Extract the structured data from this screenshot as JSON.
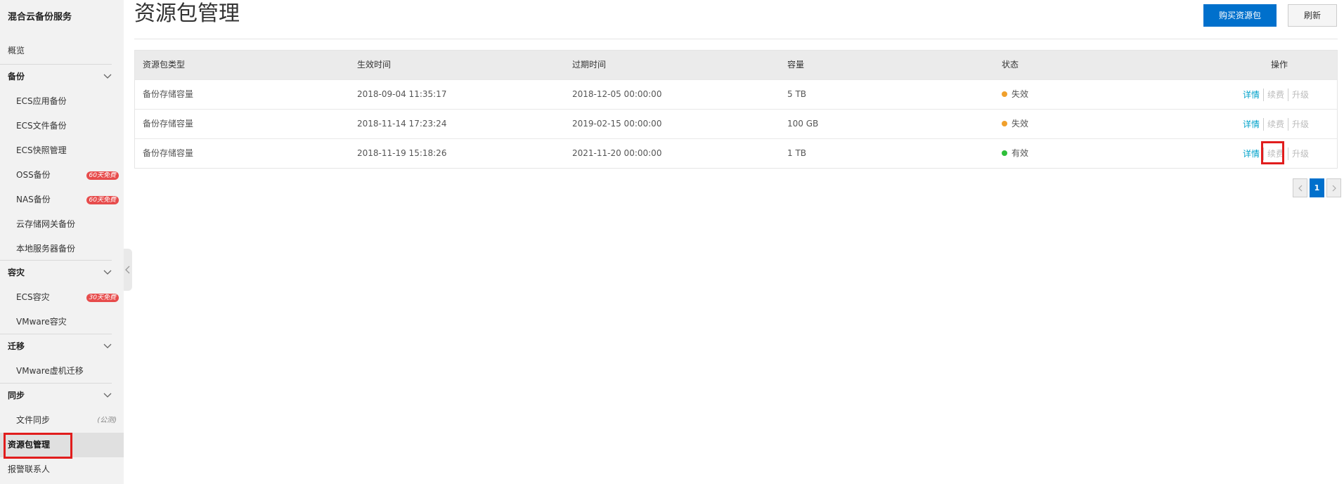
{
  "sidebar": {
    "title": "混合云备份服务",
    "overview": "概览",
    "groups": [
      {
        "label": "备份",
        "items": [
          {
            "label": "ECS应用备份"
          },
          {
            "label": "ECS文件备份"
          },
          {
            "label": "ECS快照管理"
          },
          {
            "label": "OSS备份",
            "badge": "60天免费"
          },
          {
            "label": "NAS备份",
            "badge": "60天免费"
          },
          {
            "label": "云存储网关备份"
          },
          {
            "label": "本地服务器备份"
          }
        ]
      },
      {
        "label": "容灾",
        "items": [
          {
            "label": "ECS容灾",
            "badge": "30天免费"
          },
          {
            "label": "VMware容灾"
          }
        ]
      },
      {
        "label": "迁移",
        "items": [
          {
            "label": "VMware虚机迁移"
          }
        ]
      },
      {
        "label": "同步",
        "items": [
          {
            "label": "文件同步",
            "tag": "(公测)"
          }
        ]
      }
    ],
    "resource_pkg": "资源包管理",
    "alert_contacts": "报警联系人"
  },
  "header": {
    "title": "资源包管理",
    "buy_label": "购买资源包",
    "refresh_label": "刷新"
  },
  "table": {
    "columns": [
      "资源包类型",
      "生效时间",
      "过期时间",
      "容量",
      "状态",
      "操作"
    ],
    "rows": [
      {
        "type": "备份存储容量",
        "start": "2018-09-04 11:35:17",
        "end": "2018-12-05 00:00:00",
        "capacity": "5 TB",
        "status": "失效",
        "status_color": "#f0a02c"
      },
      {
        "type": "备份存储容量",
        "start": "2018-11-14 17:23:24",
        "end": "2019-02-15 00:00:00",
        "capacity": "100 GB",
        "status": "失效",
        "status_color": "#f0a02c"
      },
      {
        "type": "备份存储容量",
        "start": "2018-11-19 15:18:26",
        "end": "2021-11-20 00:00:00",
        "capacity": "1 TB",
        "status": "有效",
        "status_color": "#2ebf3a"
      }
    ],
    "actions": {
      "detail": "详情",
      "renew": "续费",
      "upgrade": "升级"
    }
  },
  "pagination": {
    "current": "1"
  },
  "colors": {
    "primary": "#0070cc",
    "link": "#00a2ca",
    "highlight": "#e11d1d"
  }
}
